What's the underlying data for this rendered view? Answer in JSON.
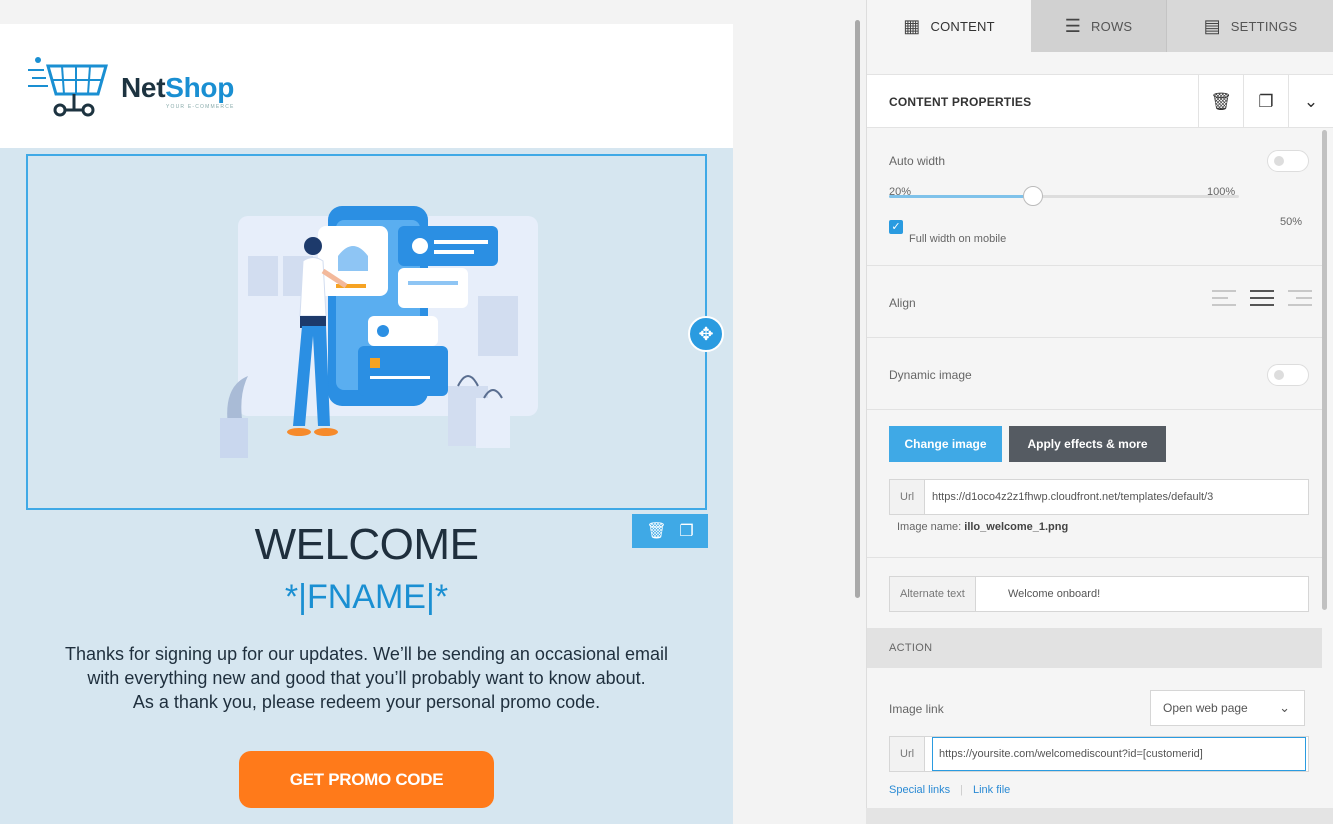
{
  "email": {
    "logo": {
      "brand_net": "Net",
      "brand_shop": "Shop",
      "tagline": "YOUR E-COMMERCE"
    },
    "heading": "WELCOME",
    "merge_tag": "*|FNAME|*",
    "body_lines": [
      "Thanks for signing up for our updates. We’ll be sending an occasional email",
      "with everything new and good that you’ll probably want to know about.",
      "As a thank you, please redeem your personal promo code."
    ],
    "cta_label": "GET PROMO CODE",
    "colors": {
      "accent": "#1a8fd2",
      "cta": "#ff7a1a",
      "body_bg": "#d6e6f0"
    }
  },
  "tabs": [
    {
      "label": "CONTENT",
      "icon": "grid-icon",
      "active": true
    },
    {
      "label": "ROWS",
      "icon": "rows-icon",
      "active": false
    },
    {
      "label": "SETTINGS",
      "icon": "settings-icon",
      "active": false
    }
  ],
  "panel": {
    "title": "CONTENT PROPERTIES",
    "auto_width": {
      "label": "Auto width",
      "enabled": false
    },
    "width_slider": {
      "min_label": "20%",
      "max_label": "100%",
      "value_label": "50%",
      "value": 0.5
    },
    "full_width_mobile": {
      "label": "Full width on mobile",
      "checked": true
    },
    "align": {
      "label": "Align",
      "selected": "center"
    },
    "dynamic_image": {
      "label": "Dynamic image",
      "enabled": false
    },
    "change_image_label": "Change image",
    "apply_effects_label": "Apply effects & more",
    "image_url": {
      "prefix": "Url",
      "value": "https://d1oco4z2z1fhwp.cloudfront.net/templates/default/3"
    },
    "image_name": {
      "label": "Image name:",
      "value": "illo_welcome_1.png"
    },
    "alt_text": {
      "prefix": "Alternate text",
      "value": "Welcome onboard!"
    },
    "action": {
      "header": "ACTION",
      "image_link_label": "Image link",
      "link_type": "Open web page",
      "url": {
        "prefix": "Url",
        "value": "https://yoursite.com/welcomediscount?id=[customerid]"
      },
      "special_links": "Special links",
      "link_file": "Link file"
    }
  }
}
